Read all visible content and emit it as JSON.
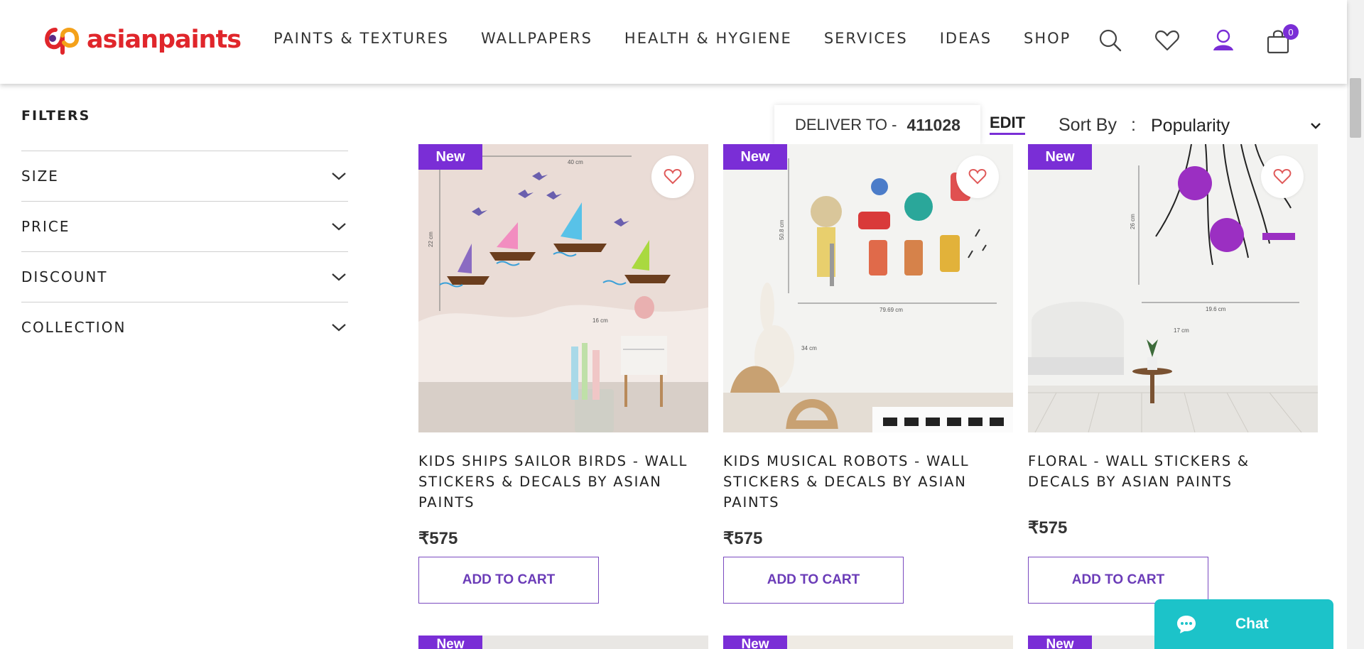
{
  "header": {
    "logo_text": "asianpaints",
    "nav": [
      "PAINTS & TEXTURES",
      "WALLPAPERS",
      "HEALTH & HYGIENE",
      "SERVICES",
      "IDEAS",
      "SHOP"
    ],
    "icons": [
      "search-icon",
      "wishlist-icon",
      "user-icon",
      "cart-icon"
    ],
    "cart_count": "0"
  },
  "filters": {
    "title": "FILTERS",
    "items": [
      "SIZE",
      "PRICE",
      "DISCOUNT",
      "COLLECTION"
    ]
  },
  "toolbar": {
    "deliver_label": "DELIVER TO -",
    "pincode": "411028",
    "edit_label": "EDIT",
    "sort_label": "Sort By",
    "sort_separator": ":",
    "sort_value": "Popularity"
  },
  "products": [
    {
      "badge": "New",
      "title": "KIDS SHIPS SAILOR BIRDS - WALL STICKERS & DECALS BY ASIAN PAINTS",
      "price": "₹575",
      "cta": "ADD TO CART",
      "image_labels": {
        "a": "40 cm",
        "b": "22 cm",
        "c": "16 cm"
      }
    },
    {
      "badge": "New",
      "title": "KIDS MUSICAL ROBOTS - WALL STICKERS & DECALS BY ASIAN PAINTS",
      "price": "₹575",
      "cta": "ADD TO CART",
      "image_labels": {
        "a": "50.8 cm",
        "b": "79.69 cm",
        "c": "34 cm"
      }
    },
    {
      "badge": "New",
      "title": "FLORAL - WALL STICKERS & DECALS BY ASIAN PAINTS",
      "price": "₹575",
      "cta": "ADD TO CART",
      "image_labels": {
        "a": "26 cm",
        "b": "19.6 cm",
        "c": "17 cm"
      }
    }
  ],
  "next_row_badges": [
    "New",
    "New",
    "New"
  ],
  "chat": {
    "label": "Chat"
  },
  "colors": {
    "brand_purple": "#7a2ed6",
    "logo_red": "#e0262b",
    "chat_teal": "#1cc3c9",
    "wish_heart": "#e05a5a"
  }
}
